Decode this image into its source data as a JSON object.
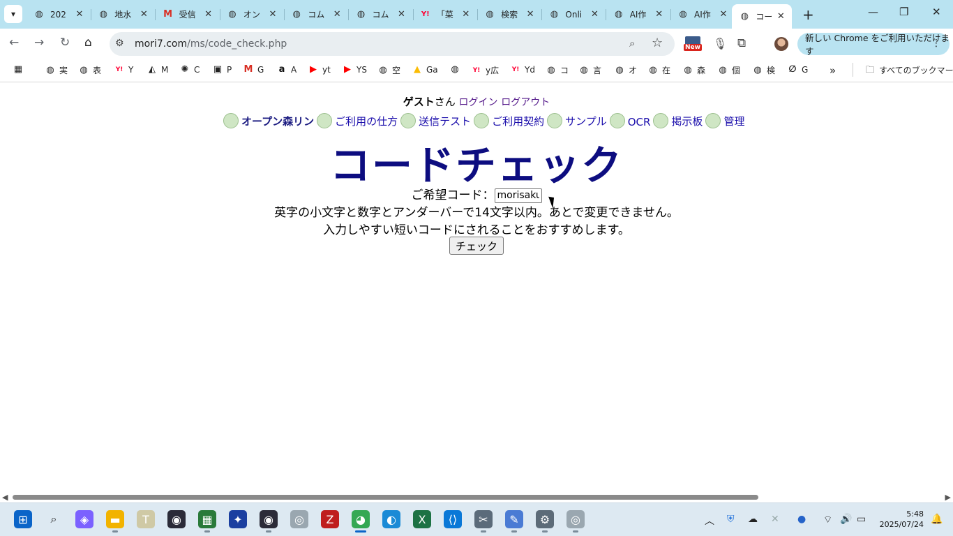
{
  "browser": {
    "tabs": [
      {
        "title": "202",
        "favicon": "globe-icon"
      },
      {
        "title": "地水",
        "favicon": "globe-icon"
      },
      {
        "title": "受信",
        "favicon": "gmail-icon"
      },
      {
        "title": "オン",
        "favicon": "globe-icon"
      },
      {
        "title": "コム",
        "favicon": "globe-icon"
      },
      {
        "title": "コム",
        "favicon": "globe-icon"
      },
      {
        "title": "「菜",
        "favicon": "yahoo-icon"
      },
      {
        "title": "検索",
        "favicon": "globe-icon"
      },
      {
        "title": "Onli",
        "favicon": "globe-icon"
      },
      {
        "title": "AI作",
        "favicon": "globe-icon"
      },
      {
        "title": "AI作",
        "favicon": "globe-icon"
      },
      {
        "title": "コー",
        "favicon": "globe-icon",
        "active": true
      }
    ],
    "url_host": "mori7.com",
    "url_path": "/ms/code_check.php",
    "ext_badge": "New",
    "update_label": "新しい Chrome をご利用いただけます",
    "bookmarks": [
      {
        "label": "",
        "icon": "apps-grid-icon"
      },
      {
        "label": "実",
        "icon": "globe-icon"
      },
      {
        "label": "表",
        "icon": "globe-icon"
      },
      {
        "label": "Y",
        "icon": "yahoo-icon"
      },
      {
        "label": "M",
        "icon": "m-logo-icon"
      },
      {
        "label": "C",
        "icon": "openai-icon"
      },
      {
        "label": "P",
        "icon": "p-logo-icon"
      },
      {
        "label": "G",
        "icon": "gmail-icon"
      },
      {
        "label": "A",
        "icon": "amazon-icon"
      },
      {
        "label": "yt",
        "icon": "youtube-icon"
      },
      {
        "label": "YS",
        "icon": "youtube-icon"
      },
      {
        "label": "空",
        "icon": "globe-icon"
      },
      {
        "label": "Ga",
        "icon": "google-ads-icon"
      },
      {
        "label": "",
        "icon": "globe-icon"
      },
      {
        "label": "y広",
        "icon": "yahoo-icon"
      },
      {
        "label": "Yd",
        "icon": "yahoo-icon"
      },
      {
        "label": "コ",
        "icon": "globe-icon"
      },
      {
        "label": "言",
        "icon": "globe-icon"
      },
      {
        "label": "オ",
        "icon": "globe-icon"
      },
      {
        "label": "在",
        "icon": "globe-icon"
      },
      {
        "label": "森",
        "icon": "globe-icon"
      },
      {
        "label": "個",
        "icon": "globe-icon"
      },
      {
        "label": "検",
        "icon": "globe-icon"
      },
      {
        "label": "G",
        "icon": "leaf-icon"
      }
    ],
    "all_bookmarks_label": "すべてのブックマーク"
  },
  "page": {
    "guest_label": "ゲスト",
    "san_label": "さん",
    "login_link": "ログイン",
    "logout_link": "ログアウト",
    "menu": [
      {
        "label": "オープン森リン",
        "bold": true
      },
      {
        "label": "ご利用の仕方"
      },
      {
        "label": "送信テスト"
      },
      {
        "label": "ご利用契約"
      },
      {
        "label": "サンプル"
      },
      {
        "label": "OCR"
      },
      {
        "label": "掲示板"
      },
      {
        "label": "管理"
      }
    ],
    "title": "コードチェック",
    "code_label": "ご希望コード：",
    "code_value": "morisaku",
    "desc1": "英字の小文字と数字とアンダーバーで14文字以内。あとで変更できません。",
    "desc2": "入力しやすい短いコードにされることをおすすめします。",
    "check_button": "チェック"
  },
  "taskbar": {
    "time": "5:48",
    "date": "2025/07/24"
  }
}
